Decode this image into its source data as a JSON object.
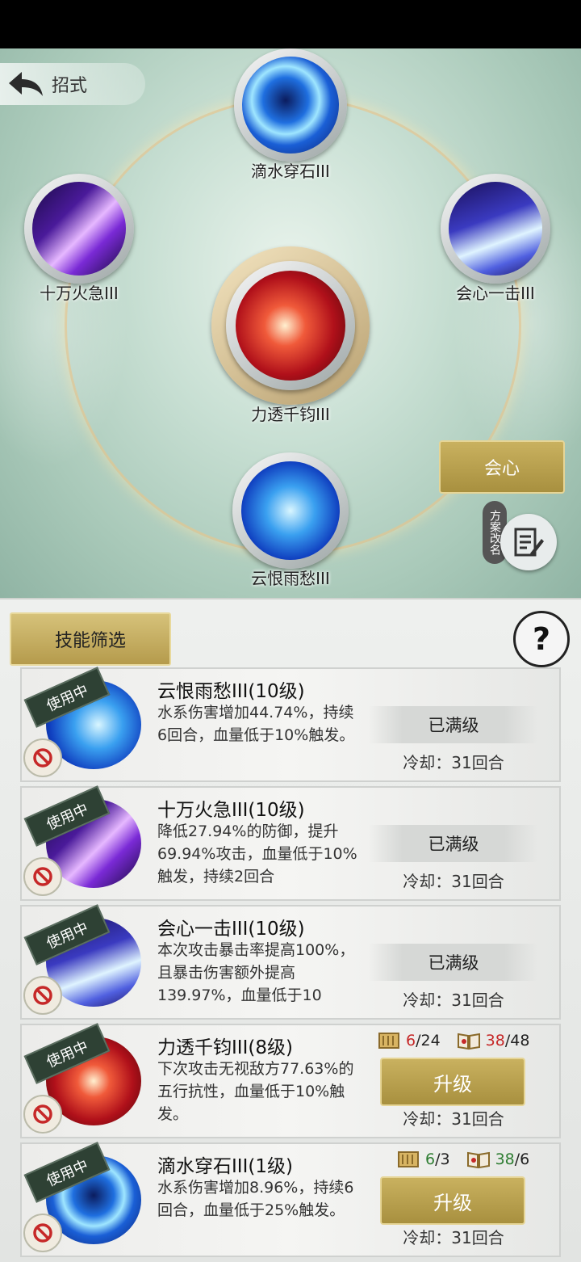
{
  "header": {
    "back_label": "招式"
  },
  "wheel": {
    "top": "滴水穿石III",
    "left": "十万火急III",
    "right": "会心一击III",
    "center": "力透千钧III",
    "bottom": "云恨雨愁III"
  },
  "scheme_button": "会心",
  "rename_label": "方案改名",
  "panel": {
    "filter_label": "技能筛选",
    "help_symbol": "?"
  },
  "skills": [
    {
      "status": "使用中",
      "title": "云恨雨愁III(10级)",
      "desc": "水系伤害增加44.74%，持续6回合，血量低于10%触发。",
      "action": "已满级",
      "cooldown": "冷却：31回合"
    },
    {
      "status": "使用中",
      "title": "十万火急III(10级)",
      "desc": "降低27.94%的防御，提升69.94%攻击，血量低于10%触发，持续2回合",
      "action": "已满级",
      "cooldown": "冷却：31回合"
    },
    {
      "status": "使用中",
      "title": "会心一击III(10级)",
      "desc": "本次攻击暴击率提高100%，且暴击伤害额外提高139.97%，血量低于10",
      "action": "已满级",
      "cooldown": "冷却：31回合"
    },
    {
      "status": "使用中",
      "title": "力透千钧III(8级)",
      "desc": "下次攻击无视敌方77.63%的五行抗性，血量低于10%触发。",
      "action": "升级",
      "cooldown": "冷却：31回合",
      "mat1_have": "6",
      "mat1_need": "/24",
      "mat2_have": "38",
      "mat2_need": "/48"
    },
    {
      "status": "使用中",
      "title": "滴水穿石III(1级)",
      "desc": "水系伤害增加8.96%，持续6回合，血量低于25%触发。",
      "action": "升级",
      "cooldown": "冷却：31回合",
      "mat1_have": "6",
      "mat1_need": "/3",
      "mat2_have": "38",
      "mat2_need": "/6"
    }
  ]
}
